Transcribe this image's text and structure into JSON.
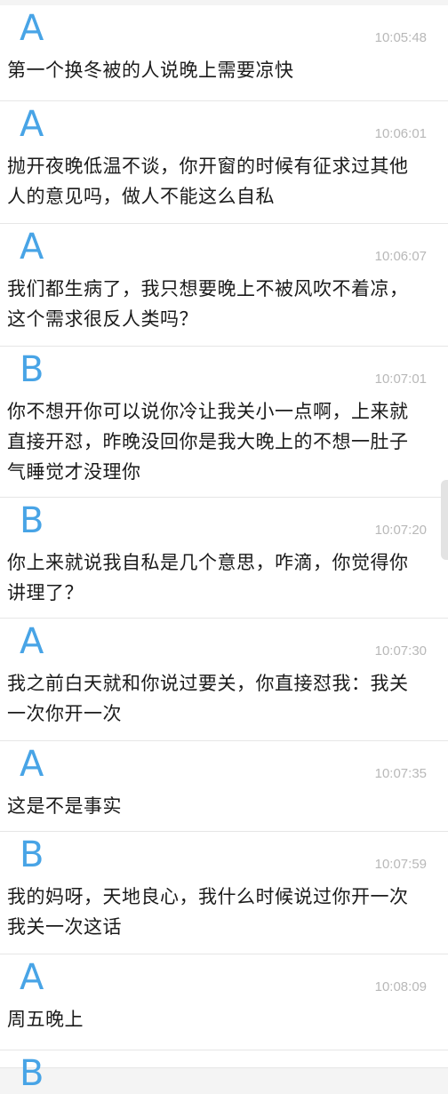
{
  "messages": [
    {
      "sender": "A",
      "time": "10:05:48",
      "text": "第一个换冬被的人说晚上需要凉快"
    },
    {
      "sender": "A",
      "time": "10:06:01",
      "text": "抛开夜晚低温不谈，你开窗的时候有征求过其他人的意见吗，做人不能这么自私"
    },
    {
      "sender": "A",
      "time": "10:06:07",
      "text": "我们都生病了，我只想要晚上不被风吹不着凉，这个需求很反人类吗？"
    },
    {
      "sender": "B",
      "time": "10:07:01",
      "text": "你不想开你可以说你冷让我关小一点啊，上来就直接开怼，昨晚没回你是我大晚上的不想一肚子气睡觉才没理你"
    },
    {
      "sender": "B",
      "time": "10:07:20",
      "text": "你上来就说我自私是几个意思，咋滴，你觉得你讲理了？"
    },
    {
      "sender": "A",
      "time": "10:07:30",
      "text": "我之前白天就和你说过要关，你直接怼我：我关一次你开一次"
    },
    {
      "sender": "A",
      "time": "10:07:35",
      "text": "这是不是事实"
    },
    {
      "sender": "B",
      "time": "10:07:59",
      "text": "我的妈呀，天地良心，我什么时候说过你开一次我关一次这话"
    },
    {
      "sender": "A",
      "time": "10:08:09",
      "text": "周五晚上"
    },
    {
      "sender": "B",
      "time": "",
      "text": ""
    }
  ]
}
